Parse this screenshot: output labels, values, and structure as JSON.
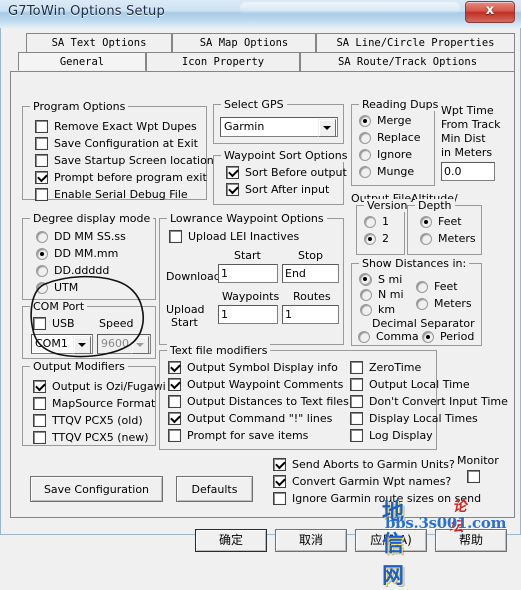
{
  "window": {
    "title": "G7ToWin Options Setup",
    "close_label": "x",
    "close_icon": "close-icon"
  },
  "tabs": {
    "row1": [
      {
        "label": "SA Text Options",
        "active": false
      },
      {
        "label": "SA Map Options",
        "active": false
      },
      {
        "label": "SA Line/Circle Properties",
        "active": false
      }
    ],
    "row2": [
      {
        "label": "General",
        "active": true
      },
      {
        "label": "Icon Property",
        "active": false
      },
      {
        "label": "SA Route/Track Options",
        "active": false
      }
    ]
  },
  "program_options": {
    "legend": "Program Options",
    "items": [
      {
        "label": "Remove Exact Wpt Dupes",
        "checked": false
      },
      {
        "label": "Save Configuration at Exit",
        "checked": false
      },
      {
        "label": "Save Startup Screen location",
        "checked": false
      },
      {
        "label": "Prompt before program exit",
        "checked": true
      },
      {
        "label": "Enable Serial Debug File",
        "checked": false
      }
    ]
  },
  "degree_display": {
    "legend": "Degree display mode",
    "items": [
      {
        "label": "DD MM SS.ss",
        "selected": false
      },
      {
        "label": "DD MM.mm",
        "selected": true
      },
      {
        "label": "DD.ddddd",
        "selected": false
      },
      {
        "label": "UTM",
        "selected": false
      }
    ]
  },
  "com_port": {
    "legend": "COM Port",
    "usb_label": "USB",
    "usb_checked": false,
    "speed_label": "Speed",
    "port_value": "COM1",
    "speed_value": "9600",
    "speed_disabled": true
  },
  "output_modifiers": {
    "legend": "Output Modifiers",
    "items": [
      {
        "label": "Output is Ozi/Fugawi",
        "checked": true
      },
      {
        "label": "MapSource Format",
        "checked": false
      },
      {
        "label": "TTQV PCX5 (old)",
        "checked": false
      },
      {
        "label": "TTQV PCX5 (new)",
        "checked": false
      }
    ]
  },
  "select_gps": {
    "legend": "Select GPS",
    "value": "Garmin"
  },
  "waypoint_sort": {
    "legend": "Waypoint Sort Options",
    "items": [
      {
        "label": "Sort Before output",
        "checked": true
      },
      {
        "label": "Sort After input",
        "checked": true
      }
    ]
  },
  "lowrance": {
    "legend": "Lowrance Waypoint Options",
    "upload_lei_label": "Upload LEI Inactives",
    "upload_lei_checked": false,
    "col_start": "Start",
    "col_stop": "Stop",
    "row_download": "Download",
    "download_start": "1",
    "download_stop": "End",
    "col_waypoints": "Waypoints",
    "col_routes": "Routes",
    "row_upload_line1": "Upload",
    "row_upload_line2": "Start",
    "upload_waypoints": "1",
    "upload_routes": "1"
  },
  "text_file_modifiers": {
    "legend": "Text file modifiers",
    "left": [
      {
        "label": "Output Symbol Display info",
        "checked": true
      },
      {
        "label": "Output Waypoint Comments",
        "checked": true
      },
      {
        "label": "Output Distances to Text files",
        "checked": false
      },
      {
        "label": "Output Command \"!\" lines",
        "checked": true
      },
      {
        "label": "Prompt for save items",
        "checked": false
      }
    ],
    "right": [
      {
        "label": "ZeroTime",
        "checked": false
      },
      {
        "label": "Output Local Time",
        "checked": false
      },
      {
        "label": "Don't Convert Input Time",
        "checked": false
      },
      {
        "label": "Display Local Times",
        "checked": false
      },
      {
        "label": "Log Display",
        "checked": false
      }
    ]
  },
  "reading_dups": {
    "legend": "Reading Dups",
    "items": [
      {
        "label": "Merge",
        "selected": true
      },
      {
        "label": "Replace",
        "selected": false
      },
      {
        "label": "Ignore",
        "selected": false
      },
      {
        "label": "Munge",
        "selected": false
      }
    ]
  },
  "wpt_time": {
    "line1": "Wpt Time",
    "line2": "From Track",
    "line3": "Min Dist",
    "line4": "in Meters",
    "value": "0.0"
  },
  "output_file": {
    "caption": "Output File",
    "legend": "Version",
    "items": [
      {
        "label": "1",
        "selected": false
      },
      {
        "label": "2",
        "selected": true
      }
    ]
  },
  "altitude_depth": {
    "caption": "Altitude/",
    "legend": "Depth",
    "items": [
      {
        "label": "Feet",
        "selected": true
      },
      {
        "label": "Meters",
        "selected": false
      }
    ]
  },
  "show_distances": {
    "legend": "Show Distances in:",
    "left": [
      {
        "label": "S mi",
        "selected": true
      },
      {
        "label": "N mi",
        "selected": false
      },
      {
        "label": "km",
        "selected": false
      }
    ],
    "right": [
      {
        "label": "Feet",
        "selected": false
      },
      {
        "label": "Meters",
        "selected": false
      }
    ],
    "decimal_separator_label": "Decimal Separator",
    "separators": [
      {
        "label": "Comma",
        "selected": false
      },
      {
        "label": "Period",
        "selected": true
      }
    ]
  },
  "garmin_options": {
    "items": [
      {
        "label": "Send Aborts to Garmin Units?",
        "checked": true
      },
      {
        "label": "Convert Garmin Wpt names?",
        "checked": true
      },
      {
        "label": "Ignore Garmin route sizes on send",
        "checked": false
      }
    ],
    "monitor_label": "Monitor",
    "monitor_checked": false
  },
  "panel_buttons": {
    "save_configuration": "Save Configuration",
    "defaults": "Defaults"
  },
  "footer_buttons": {
    "ok": "确定",
    "cancel": "取消",
    "apply": "应用(A)",
    "help": "帮助"
  },
  "watermark": {
    "site_cn": "地信网",
    "forum_cn": "论坛",
    "url": "bbs.3s001.com"
  }
}
